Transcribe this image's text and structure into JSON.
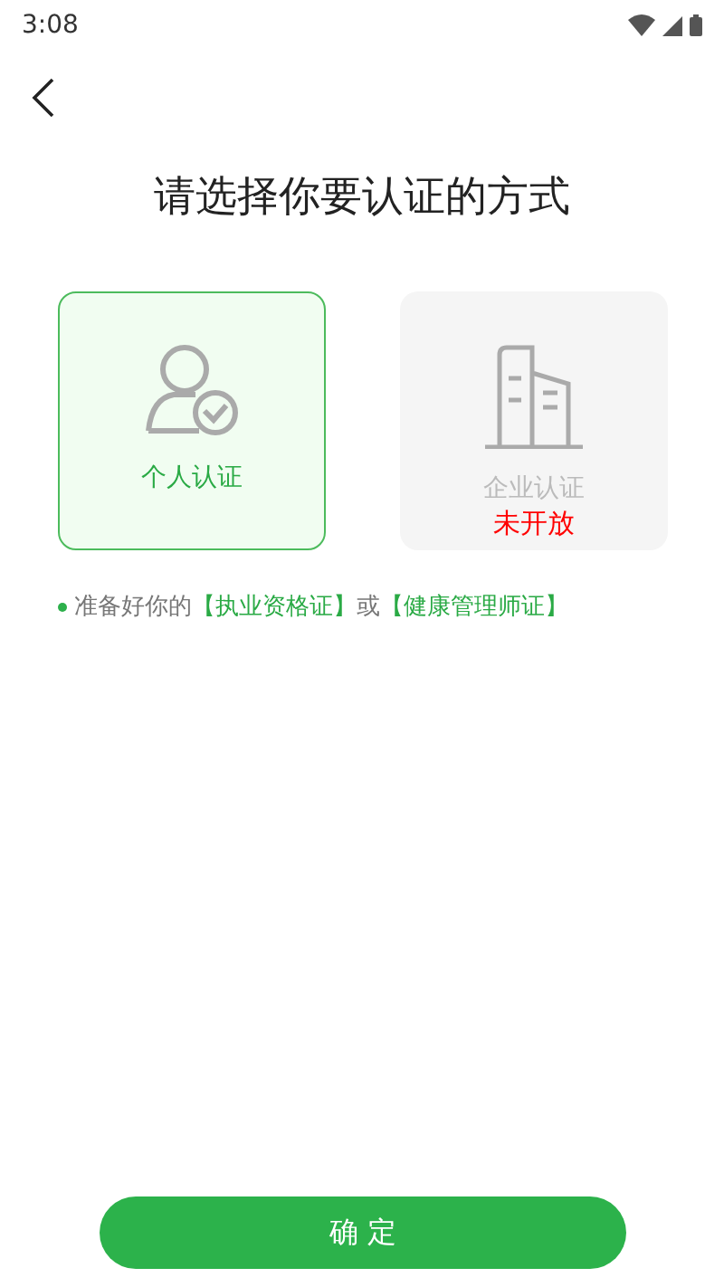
{
  "status_bar": {
    "time": "3:08"
  },
  "title": "请选择你要认证的方式",
  "options": [
    {
      "kind": "person",
      "label": "个人认证",
      "selected": true,
      "disabled": false
    },
    {
      "kind": "company",
      "label": "企业认证",
      "status": "未开放",
      "selected": false,
      "disabled": true
    }
  ],
  "note": [
    {
      "kind": "plain",
      "text": "准备好你的"
    },
    {
      "kind": "highlight",
      "text": "【执业资格证】"
    },
    {
      "kind": "plain",
      "text": "或"
    },
    {
      "kind": "highlight",
      "text": "【健康管理师证】"
    }
  ],
  "confirm_button": "确 定"
}
